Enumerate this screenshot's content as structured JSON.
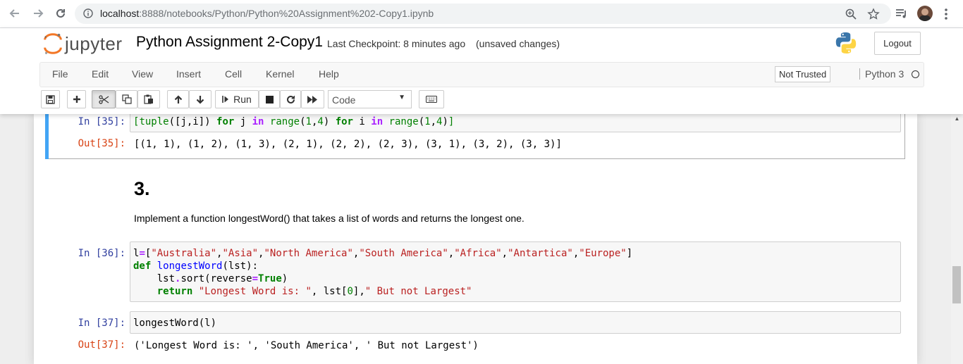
{
  "browser": {
    "url_host": "localhost",
    "url_path": ":8888/notebooks/Python/Python%20Assignment%202-Copy1.ipynb"
  },
  "header": {
    "logo_text": "jupyter",
    "notebook_title": "Python Assignment 2-Copy1",
    "checkpoint": "Last Checkpoint: 8 minutes ago",
    "unsaved": "(unsaved changes)",
    "logout_label": "Logout"
  },
  "menubar": {
    "items": [
      "File",
      "Edit",
      "View",
      "Insert",
      "Cell",
      "Kernel",
      "Help"
    ],
    "trust_label": "Not Trusted",
    "kernel_name": "Python 3"
  },
  "toolbar": {
    "run_label": "Run",
    "cell_type": "Code",
    "cell_type_options": [
      "Code"
    ]
  },
  "cells": {
    "c35": {
      "in_prompt": "In [35]:",
      "out_prompt": "Out[35]:",
      "output": "[(1, 1), (1, 2), (1, 3), (2, 1), (2, 2), (2, 3), (3, 1), (3, 2), (3, 3)]"
    },
    "markdown": {
      "heading": "3.",
      "text": "Implement a function longestWord() that takes a list of words and returns the longest one."
    },
    "c36": {
      "in_prompt": "In [36]:"
    },
    "c37": {
      "in_prompt": "In [37]:",
      "code": "longestWord(l)",
      "out_prompt": "Out[37]:",
      "output": "('Longest Word is: ', 'South America', ' But not Largest')"
    }
  },
  "colors": {
    "selected_bar": "#42a5f5",
    "in_prompt": "#303f9f",
    "out_prompt": "#d84315",
    "keyword": "#008000",
    "string": "#ba2121"
  }
}
